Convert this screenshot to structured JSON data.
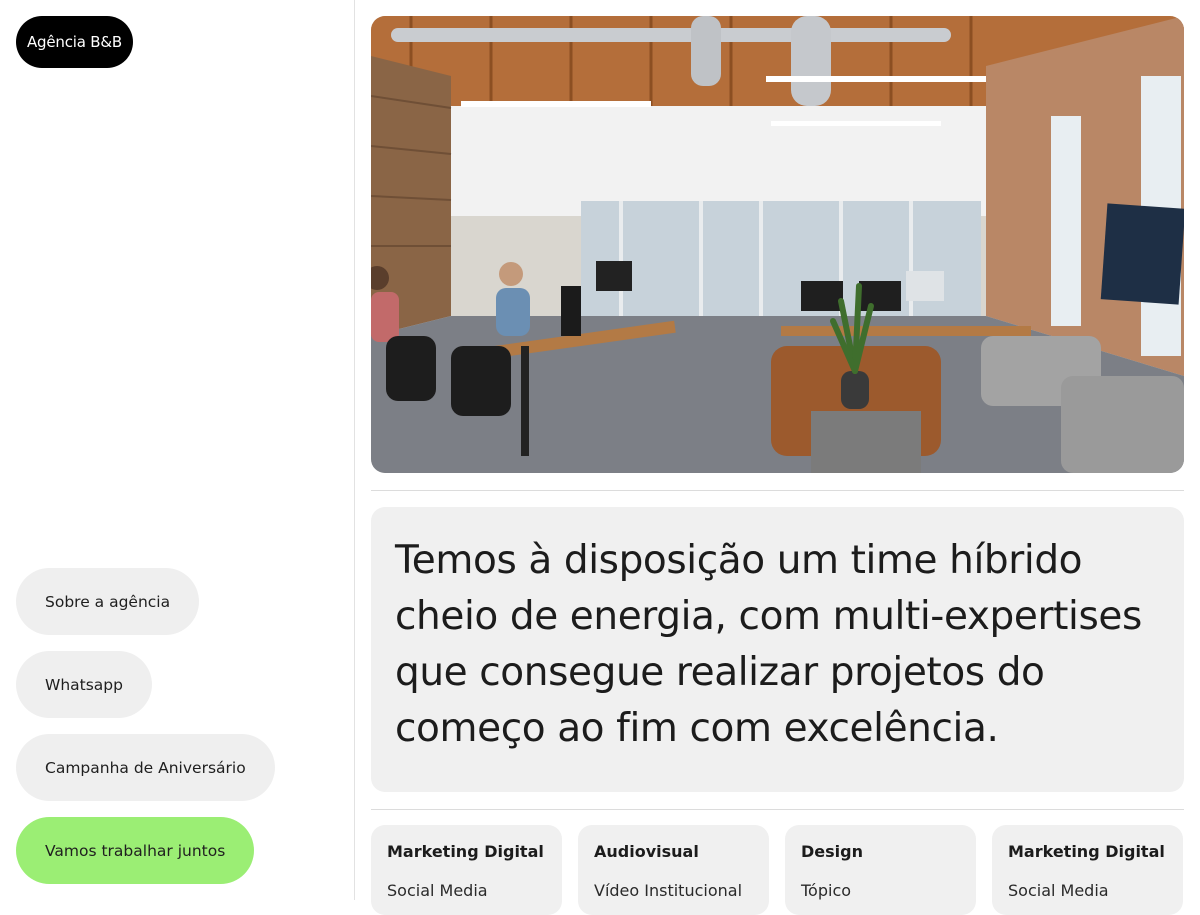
{
  "brand": {
    "label": "Agência B&B"
  },
  "nav": {
    "items": [
      {
        "label": "Sobre a agência"
      },
      {
        "label": "Whatsapp"
      },
      {
        "label": "Campanha de Aniversário"
      },
      {
        "label": "Vamos trabalhar juntos"
      }
    ]
  },
  "statement": {
    "text": "Temos à disposição um time híbrido cheio de energia, com multi-expertises que consegue realizar projetos do começo ao fim com excelência."
  },
  "cards": [
    {
      "title": "Marketing Digital",
      "item": "Social Media"
    },
    {
      "title": "Audiovisual",
      "item": "Vídeo Institucional"
    },
    {
      "title": "Design",
      "item": "Tópico"
    },
    {
      "title": "Marketing Digital",
      "item": "Social Media"
    }
  ],
  "colors": {
    "cta": "#9bee74",
    "pill": "#efefef",
    "logo": "#000000",
    "panel": "#f0f0f0"
  }
}
